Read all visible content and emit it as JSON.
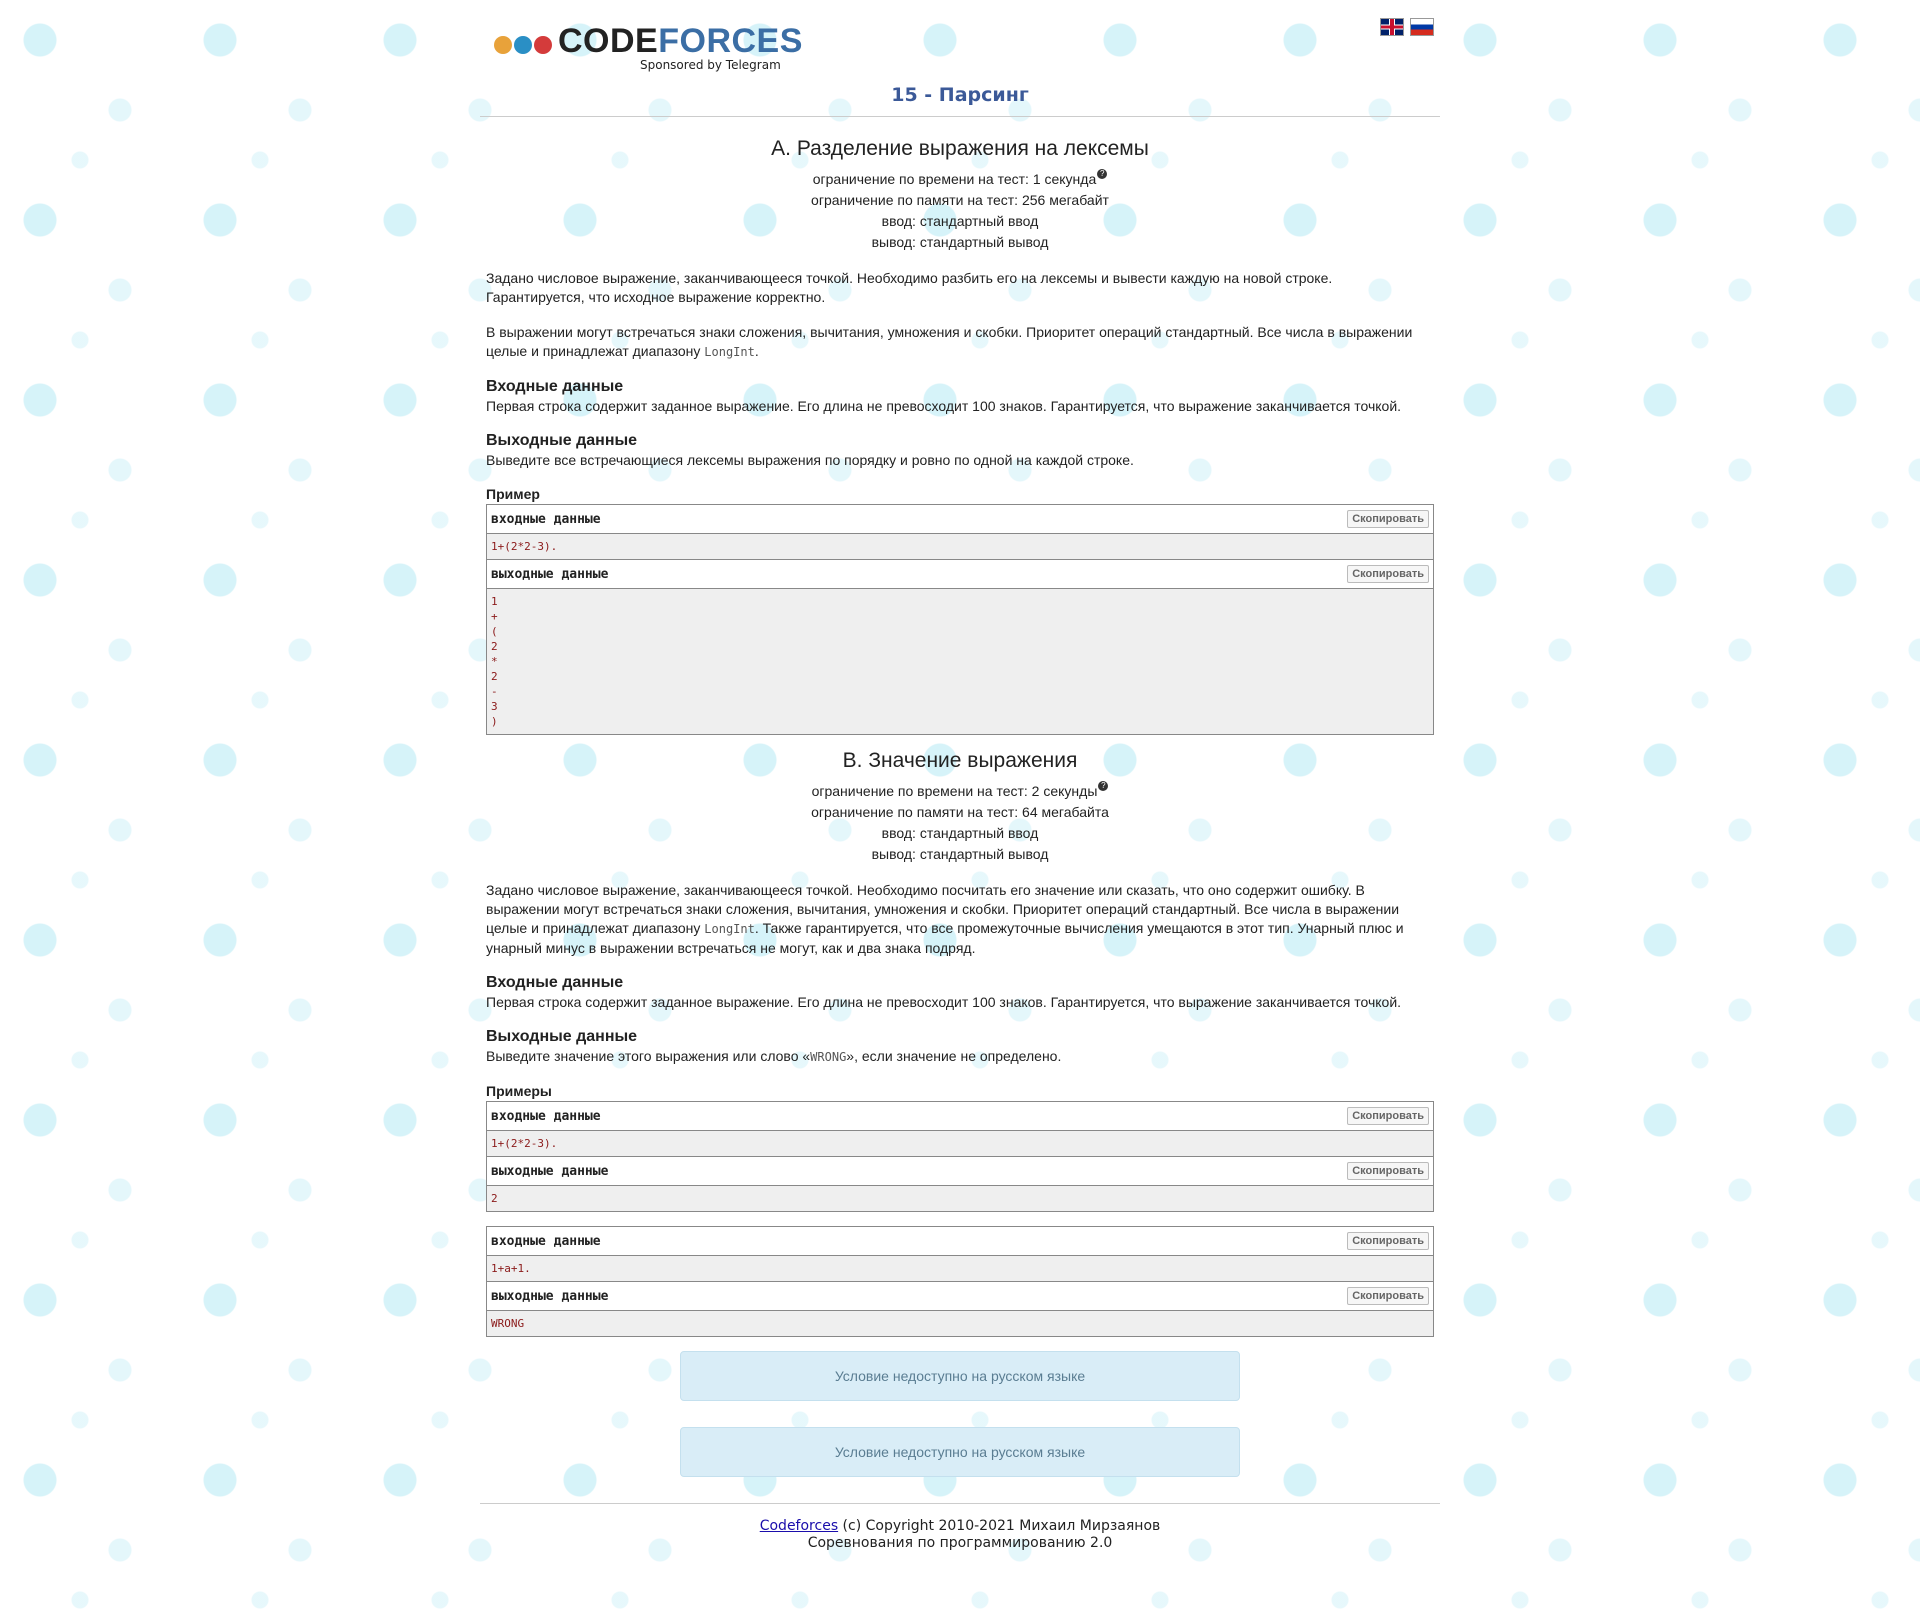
{
  "header": {
    "logo_code": "CODE",
    "logo_forces": "FORCES",
    "logo_sponsor": "Sponsored by Telegram",
    "lang_en_icon": "flag-uk-icon",
    "lang_ru_icon": "flag-ru-icon"
  },
  "contest": {
    "title": "15 - Парсинг"
  },
  "problemA": {
    "title": "A. Разделение выражения на лексемы",
    "time_limit": "ограничение по времени на тест: 1 секунда",
    "memory_limit": "ограничение по памяти на тест: 256 мегабайт",
    "input": "ввод: стандартный ввод",
    "output": "вывод: стандартный вывод",
    "statement_1": "Задано числовое выражение, заканчивающееся точкой. Необходимо разбить его на лексемы и вывести каждую на новой строке. Гарантируется, что исходное выражение корректно.",
    "statement_2_pre": "В выражении могут встречаться знаки сложения, вычитания, умножения и скобки. Приоритет операций стандартный. Все числа в выражении целые и принадлежат диапазону ",
    "statement_2_code": "LongInt",
    "statement_2_post": ".",
    "input_title": "Входные данные",
    "input_text": "Первая строка содержит заданное выражение. Его длина не превосходит 100 знаков. Гарантируется, что выражение заканчивается точкой.",
    "output_title": "Выходные данные",
    "output_text": "Выведите все встречающиеся лексемы выражения по порядку и ровно по одной на каждой строке.",
    "samples_title": "Пример",
    "input_label": "входные данные",
    "output_label": "выходные данные",
    "copy_label": "Скопировать",
    "sample_input": "1+(2*2-3).",
    "sample_output": "1\n+\n(\n2\n*\n2\n-\n3\n)"
  },
  "problemB": {
    "title": "B. Значение выражения",
    "time_limit": "ограничение по времени на тест: 2 секунды",
    "memory_limit": "ограничение по памяти на тест: 64 мегабайта",
    "input": "ввод: стандартный ввод",
    "output": "вывод: стандартный вывод",
    "statement_pre": "Задано числовое выражение, заканчивающееся точкой. Необходимо посчитать его значение или сказать, что оно содержит ошибку. В выражении могут встречаться знаки сложения, вычитания, умножения и скобки. Приоритет операций стандартный. Все числа в выражении целые и принадлежат диапазону ",
    "statement_code": "LongInt",
    "statement_post": ". Также гарантируется, что все промежуточные вычисления умещаются в этот тип. Унарный плюс и унарный минус в выражении встречаться не могут, как и два знака подряд.",
    "input_title": "Входные данные",
    "input_text": "Первая строка содержит заданное выражение. Его длина не превосходит 100 знаков. Гарантируется, что выражение заканчивается точкой.",
    "output_title": "Выходные данные",
    "output_pre": "Выведите значение этого выражения или слово «",
    "output_code": "WRONG",
    "output_post": "», если значение не определено.",
    "samples_title": "Примеры",
    "input_label": "входные данные",
    "output_label": "выходные данные",
    "copy_label": "Скопировать",
    "sample1_input": "1+(2*2-3).",
    "sample1_output": "2",
    "sample2_input": "1+a+1.",
    "sample2_output": "WRONG"
  },
  "notices": {
    "notice_1": "Условие недоступно на русском языке",
    "notice_2": "Условие недоступно на русском языке"
  },
  "footer": {
    "link": "Codeforces",
    "copyright": " (c) Copyright 2010-2021 Михаил Мирзаянов",
    "line2": "Соревнования по программированию 2.0"
  }
}
